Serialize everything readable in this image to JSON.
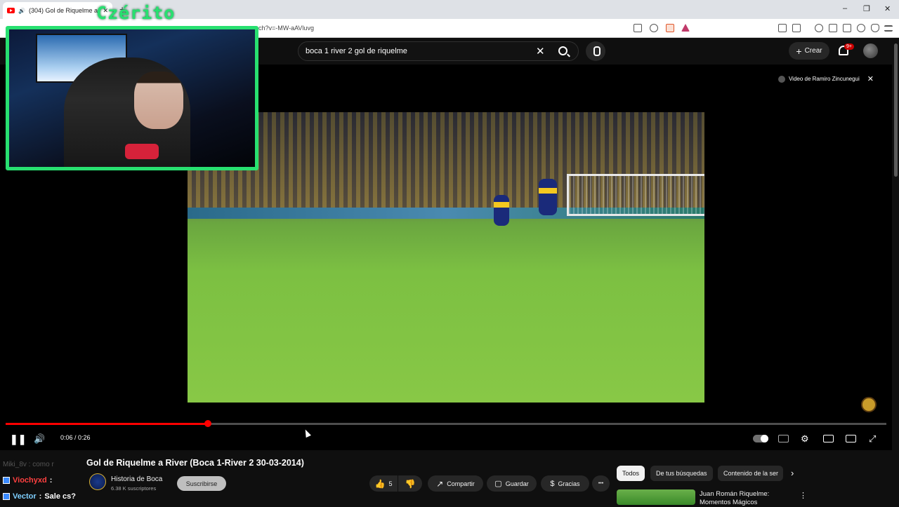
{
  "browser": {
    "tab_title": "(304) Gol de Riquelme a River",
    "url": "ch?v=-MW-aAVluvg",
    "new_tab_label": "+",
    "window_controls": [
      "–",
      "❐",
      "✕"
    ]
  },
  "header": {
    "search_value": "boca 1 river 2 gol de riquelme",
    "clear_label": "✕",
    "create_label": "Crear",
    "notifications_badge": "9+"
  },
  "player": {
    "credit": "Video de Ramiro Zincunegui",
    "credit_close": "✕",
    "time": "0:06 / 0:26",
    "progress_fraction": 0.23,
    "colors": {
      "progress": "#ff0000",
      "webcam_border": "#28e070"
    }
  },
  "video": {
    "title": "Gol de Riquelme a River (Boca 1-River 2 30-03-2014)",
    "channel_name": "Historia de Boca",
    "subscribers": "6.38 K suscriptores",
    "subscribe_label": "Suscribirse",
    "like_count": "5",
    "share_label": "Compartir",
    "save_label": "Guardar",
    "thanks_label": "Gracias",
    "more_label": "•••"
  },
  "chips": {
    "items": [
      "Todos",
      "De tus búsquedas",
      "Contenido de la ser"
    ],
    "selected": "Todos"
  },
  "recommendation": {
    "title": "Juan Román Riquelme: Momentos Mágicos"
  },
  "stream": {
    "streamer_name": "Czérito",
    "chat_ghost": "Miki_8v : como r",
    "chat": [
      {
        "user": "Viochyxd",
        "message": "",
        "color": "#ff4040"
      },
      {
        "user": "Vector",
        "message": "Sale cs?",
        "color": "#7fd0ff"
      }
    ]
  }
}
